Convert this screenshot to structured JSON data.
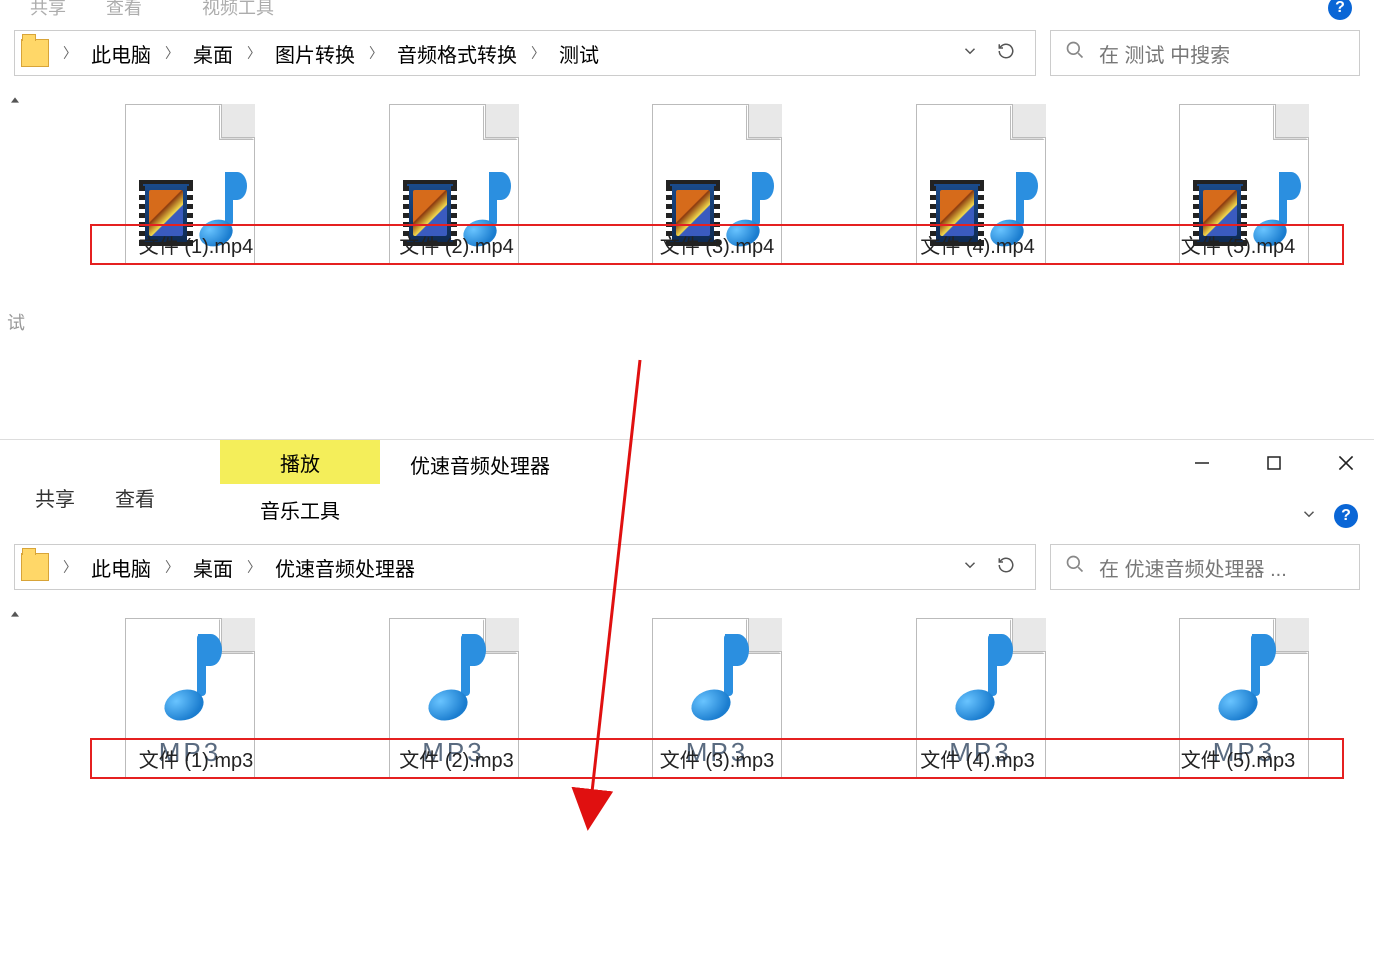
{
  "win1": {
    "ribbon": {
      "share": "共享",
      "view": "查看",
      "ctx_tool": "视频工具"
    },
    "breadcrumbs": [
      "此电脑",
      "桌面",
      "图片转换",
      "音频格式转换",
      "测试"
    ],
    "search_placeholder": "在 测试 中搜索",
    "files": [
      {
        "name": "文件 (1).mp4"
      },
      {
        "name": "文件 (2).mp4"
      },
      {
        "name": "文件 (3).mp4"
      },
      {
        "name": "文件 (4).mp4"
      },
      {
        "name": "文件 (5).mp4"
      }
    ],
    "side_cut_label": "试"
  },
  "win2": {
    "ribbon": {
      "share": "共享",
      "view": "查看",
      "play_tab": "播放",
      "music_tool": "音乐工具"
    },
    "app_title": "优速音频处理器",
    "breadcrumbs": [
      "此电脑",
      "桌面",
      "优速音频处理器"
    ],
    "search_placeholder": "在 优速音频处理器 ...",
    "mp3_tag": "MP3",
    "files": [
      {
        "name": "文件 (1).mp3"
      },
      {
        "name": "文件 (2).mp3"
      },
      {
        "name": "文件 (3).mp3"
      },
      {
        "name": "文件 (4).mp3"
      },
      {
        "name": "文件 (5).mp3"
      }
    ]
  }
}
